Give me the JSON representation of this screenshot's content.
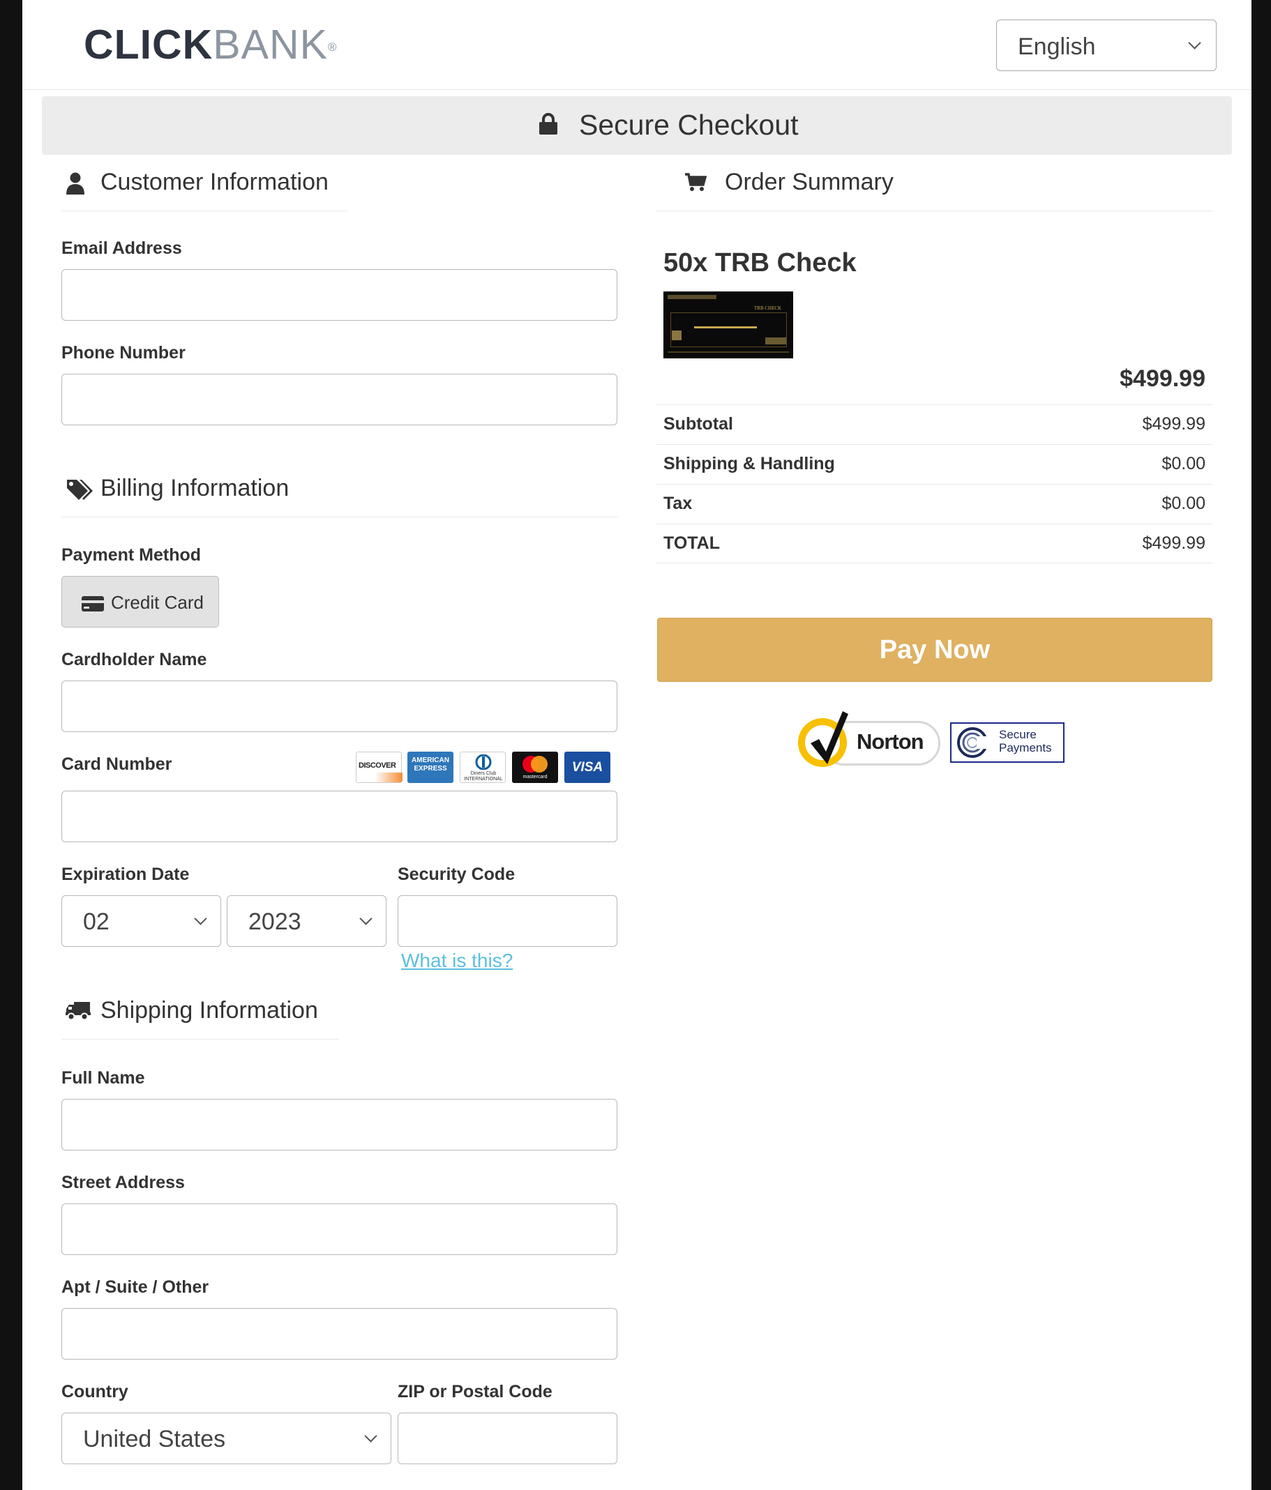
{
  "header": {
    "logo_click": "CLICK",
    "logo_bank": "BANK",
    "logo_reg": "®",
    "language": "English"
  },
  "banner": {
    "title": "Secure Checkout",
    "icon": "lock-icon"
  },
  "customer": {
    "heading": "Customer Information",
    "icon": "user-icon",
    "email_label": "Email Address",
    "email_value": "",
    "phone_label": "Phone Number",
    "phone_value": ""
  },
  "billing": {
    "heading": "Billing Information",
    "icon": "tags-icon",
    "payment_method_label": "Payment Method",
    "payment_method_button": "Credit Card",
    "cardholder_label": "Cardholder Name",
    "cardholder_value": "",
    "card_number_label": "Card Number",
    "card_number_value": "",
    "card_brands": [
      "DISCOVER",
      "AMERICAN EXPRESS",
      "Diners Club INTERNATIONAL",
      "mastercard",
      "VISA"
    ],
    "expiration_label": "Expiration Date",
    "exp_month": "02",
    "exp_year": "2023",
    "security_label": "Security Code",
    "security_value": "",
    "what_is_this": "What is this?"
  },
  "shipping": {
    "heading": "Shipping Information",
    "icon": "truck-icon",
    "full_name_label": "Full Name",
    "full_name_value": "",
    "street_label": "Street Address",
    "street_value": "",
    "apt_label": "Apt / Suite / Other",
    "apt_value": "",
    "country_label": "Country",
    "country_value": "United States",
    "zip_label": "ZIP or Postal Code",
    "zip_value": ""
  },
  "order": {
    "heading": "Order Summary",
    "icon": "shopping-cart-icon",
    "product_title": "50x TRB Check",
    "product_thumb_text": "TRB CHECK",
    "price": "$499.99",
    "rows": [
      {
        "label": "Subtotal",
        "value": "$499.99"
      },
      {
        "label": "Shipping & Handling",
        "value": "$0.00"
      },
      {
        "label": "Tax",
        "value": "$0.00"
      },
      {
        "label": "TOTAL",
        "value": "$499.99"
      }
    ],
    "pay_button": "Pay Now",
    "norton_text": "Norton",
    "secure_payments_line1": "Secure",
    "secure_payments_line2": "Payments"
  },
  "colors": {
    "pay_button": "#dfb160",
    "link": "#5bc0de",
    "banner_bg": "#ececec"
  }
}
